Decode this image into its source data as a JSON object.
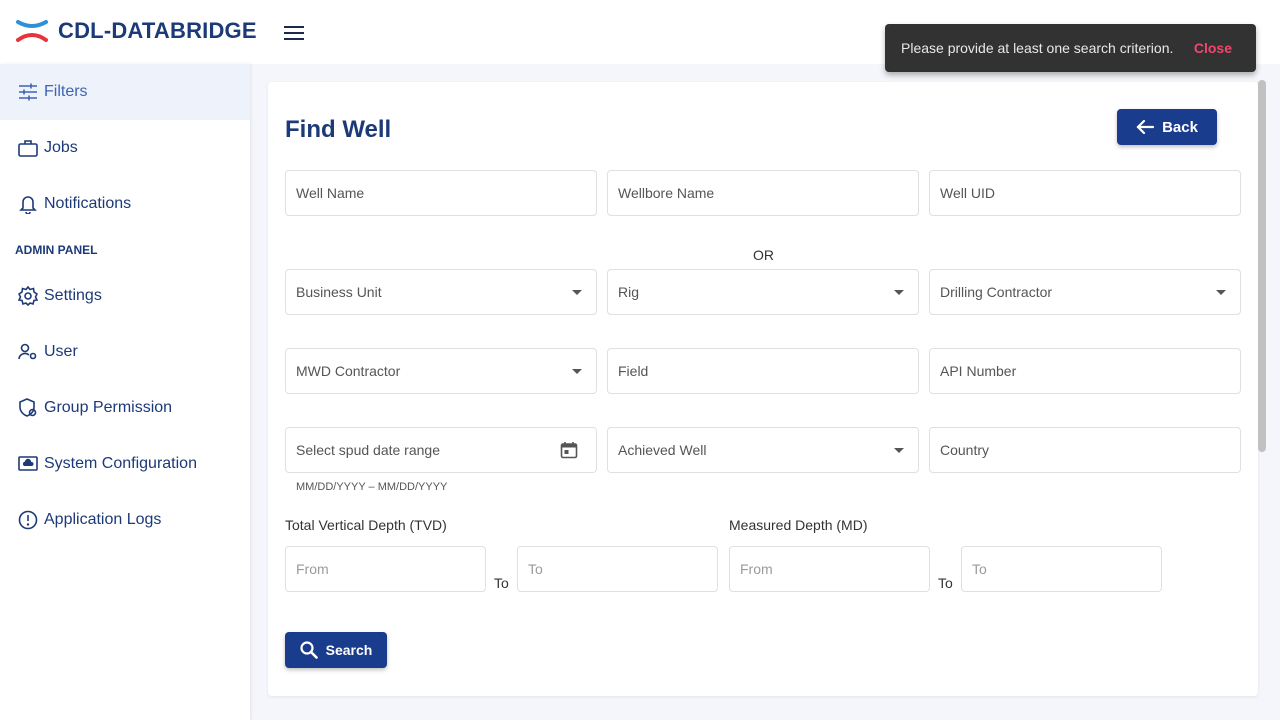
{
  "app": {
    "title": "CDL-DATABRIDGE"
  },
  "toast": {
    "message": "Please provide at least one search criterion.",
    "close_label": "Close"
  },
  "sidebar": {
    "items": [
      {
        "label": "Filters",
        "icon": "filters-icon",
        "active": true
      },
      {
        "label": "Jobs",
        "icon": "briefcase-icon"
      },
      {
        "label": "Notifications",
        "icon": "bell-icon"
      }
    ],
    "admin_label": "ADMIN PANEL",
    "admin_items": [
      {
        "label": "Settings",
        "icon": "gear-icon"
      },
      {
        "label": "User",
        "icon": "user-gear-icon"
      },
      {
        "label": "Group Permission",
        "icon": "shield-icon"
      },
      {
        "label": "System Configuration",
        "icon": "cloud-monitor-icon"
      },
      {
        "label": "Application Logs",
        "icon": "alert-circle-icon"
      }
    ]
  },
  "main": {
    "title": "Find Well",
    "back_label": "Back",
    "or_label": "OR",
    "fields": {
      "well_name": "Well Name",
      "wellbore_name": "Wellbore Name",
      "well_uid": "Well UID",
      "business_unit": "Business Unit",
      "rig": "Rig",
      "drilling_contractor": "Drilling Contractor",
      "mwd_contractor": "MWD Contractor",
      "field": "Field",
      "api_number": "API Number",
      "spud_date": "Select spud date range",
      "spud_hint": "MM/DD/YYYY – MM/DD/YYYY",
      "achieved_well": "Achieved Well",
      "country": "Country"
    },
    "tvd": {
      "label": "Total Vertical Depth (TVD)",
      "from": "From",
      "to_label": "To",
      "to": "To"
    },
    "md": {
      "label": "Measured Depth (MD)",
      "from": "From",
      "to_label": "To",
      "to": "To"
    },
    "search_label": "Search"
  },
  "colors": {
    "brand": "#1c3a78",
    "button": "#1a3c8c",
    "toast_bg": "#323232",
    "toast_action": "#ef476f"
  }
}
